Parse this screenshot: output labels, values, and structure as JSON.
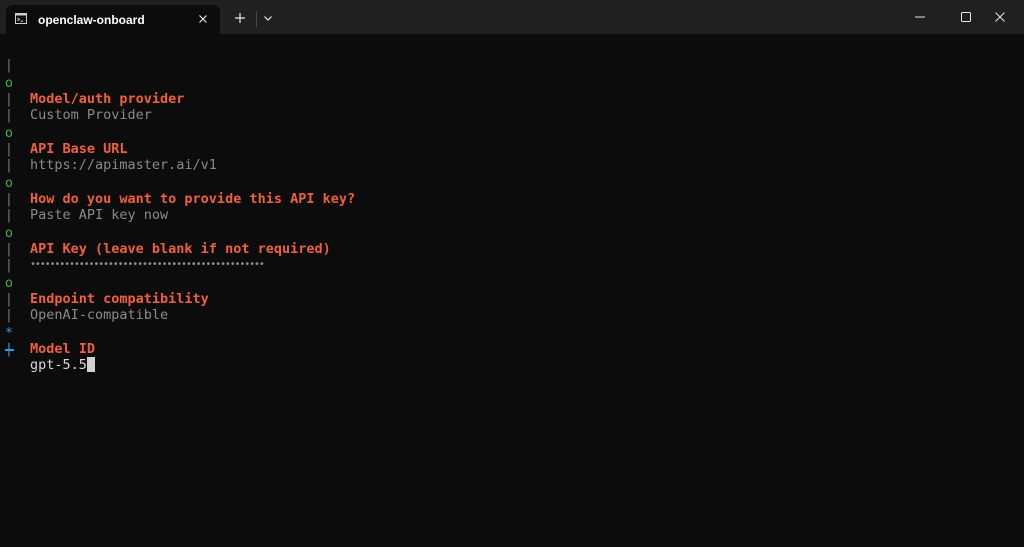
{
  "window": {
    "tab_title": "openclaw-onboard"
  },
  "glyphs": {
    "pipe": "|",
    "done": "o",
    "active": "*"
  },
  "steps": [
    {
      "label": "Model/auth provider",
      "value": "Custom Provider"
    },
    {
      "label": "API Base URL",
      "value": "https://apimaster.ai/v1"
    },
    {
      "label": "How do you want to provide this API key?",
      "value": "Paste API key now"
    },
    {
      "label": "API Key (leave blank if not required)",
      "value": "••••••••••••••••••••••••••••••••••••••••••••••••"
    },
    {
      "label": "Endpoint compatibility",
      "value": "OpenAI-compatible"
    }
  ],
  "current": {
    "label": "Model ID",
    "input": "gpt-5.5"
  },
  "colors": {
    "prompt_label": "#f0603c",
    "answer_text": "#8a8a8a",
    "done_marker": "#3ab34a",
    "active_marker": "#3a96dd",
    "background": "#0c0c0c",
    "titlebar": "#202020"
  },
  "icons": {
    "tab": "terminal-icon",
    "tab_close": "close-icon",
    "new_tab": "plus-icon",
    "dropdown": "chevron-down-icon",
    "minimize": "minimize-icon",
    "maximize": "maximize-icon",
    "close": "close-icon"
  }
}
